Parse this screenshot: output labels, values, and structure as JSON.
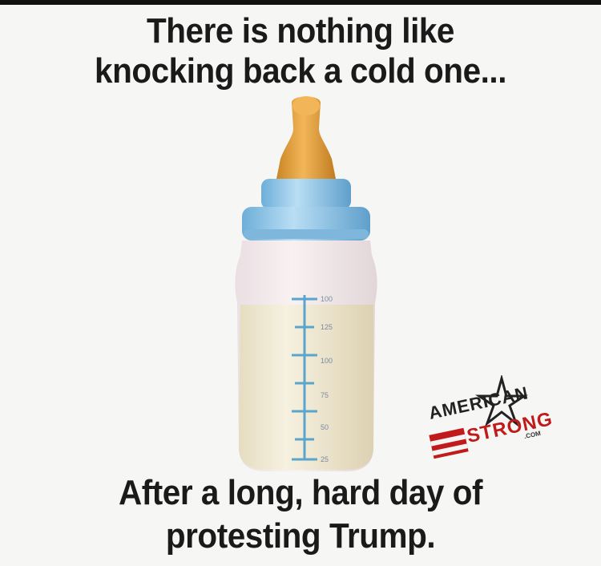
{
  "top_caption": {
    "line1": "There is nothing like",
    "line2": "knocking back a cold one..."
  },
  "bottom_caption": {
    "line1": "After a long, hard day of",
    "line2": "protesting Trump."
  },
  "bottle": {
    "icon": "baby-bottle-icon",
    "scale_marks": [
      "100",
      "125",
      "100",
      "75",
      "50",
      "25"
    ]
  },
  "watermark": {
    "line1": "AMERICAN",
    "line2": "STRONG",
    "suffix": ".COM"
  },
  "colors": {
    "background": "#f6f6f4",
    "text": "#1a1a1a",
    "nipple": "#e0a040",
    "cap": "#8ec6ea",
    "milk": "#f2ecd6",
    "scale": "#5aa5cc",
    "watermark_red": "#c11a1a"
  }
}
